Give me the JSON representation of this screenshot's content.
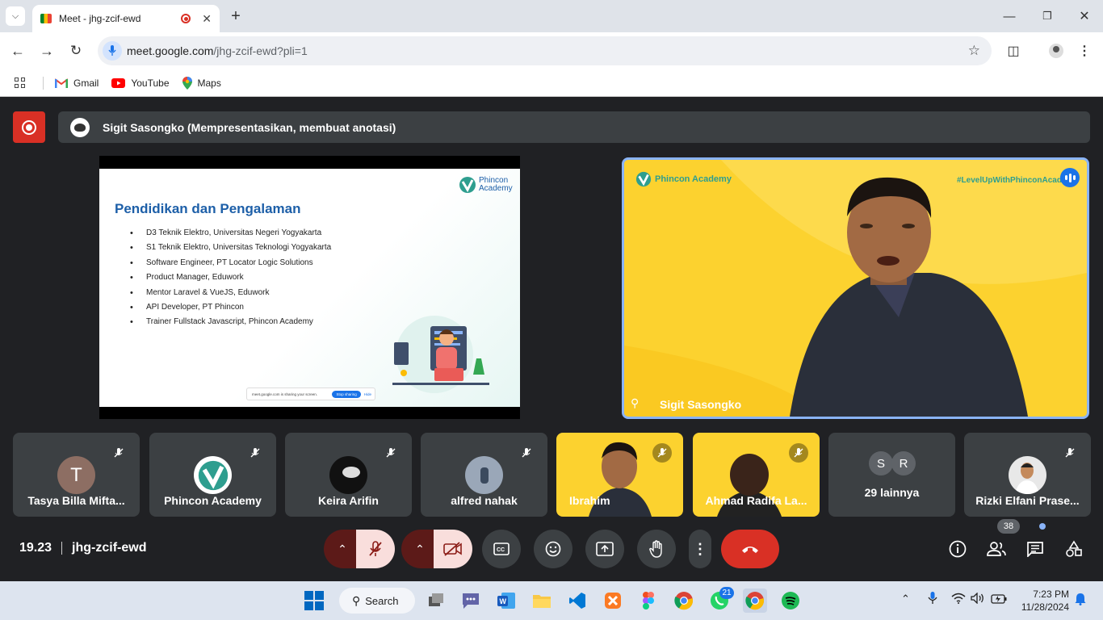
{
  "browser": {
    "tab_title": "Meet - jhg-zcif-ewd",
    "url_domain": "meet.google.com",
    "url_path": "/jhg-zcif-ewd?pli=1",
    "bookmarks": [
      {
        "label": "Gmail",
        "icon": "gmail-icon"
      },
      {
        "label": "YouTube",
        "icon": "youtube-icon"
      },
      {
        "label": "Maps",
        "icon": "maps-icon"
      }
    ]
  },
  "meet": {
    "presenter_banner": "Sigit Sasongko (Mempresentasikan, membuat anotasi)",
    "slide": {
      "logo_line1": "Phincon",
      "logo_line2": "Academy",
      "title": "Pendidikan dan Pengalaman",
      "items": [
        "D3 Teknik Elektro, Universitas Negeri Yogyakarta",
        "S1 Teknik Elektro, Universitas Teknologi Yogyakarta",
        "Software Engineer, PT Locator Logic Solutions",
        "Product Manager, Eduwork",
        "Mentor Laravel & VueJS, Eduwork",
        "API Developer, PT Phincon",
        "Trainer Fullstack Javascript, Phincon Academy"
      ],
      "share_notice": "meet.google.com is sharing your screen.",
      "stop_sharing": "Stop sharing",
      "hide": "Hide"
    },
    "speaker": {
      "name": "Sigit Sasongko",
      "brand": "Phincon Academy",
      "hashtag": "#LevelUpWithPhinconAcademy"
    },
    "participants": [
      {
        "name": "Tasya Billa Mifta...",
        "initial": "T",
        "avatar_color": "#8d6e63"
      },
      {
        "name": "Phincon Academy",
        "initial": "",
        "avatar_color": "#ffffff"
      },
      {
        "name": "Keira Arifin",
        "initial": "",
        "avatar_color": "#111111"
      },
      {
        "name": "alfred nahak",
        "initial": "",
        "avatar_color": "#9aa7b8"
      },
      {
        "name": "Ibrahim",
        "initial": "",
        "avatar_color": "#fcd22f"
      },
      {
        "name": "Ahmad Radifa La...",
        "initial": "",
        "avatar_color": "#fcd22f"
      },
      {
        "name": "Rizki Elfani Prase...",
        "initial": "",
        "avatar_color": "#e8e8e8"
      }
    ],
    "more": {
      "label": "29 lainnya",
      "initials": [
        "S",
        "R"
      ]
    },
    "time": "19.23",
    "meeting_code": "jhg-zcif-ewd",
    "participant_count": "38"
  },
  "taskbar": {
    "search_label": "Search",
    "whatsapp_badge": "21",
    "time": "7:23 PM",
    "date": "11/28/2024"
  }
}
